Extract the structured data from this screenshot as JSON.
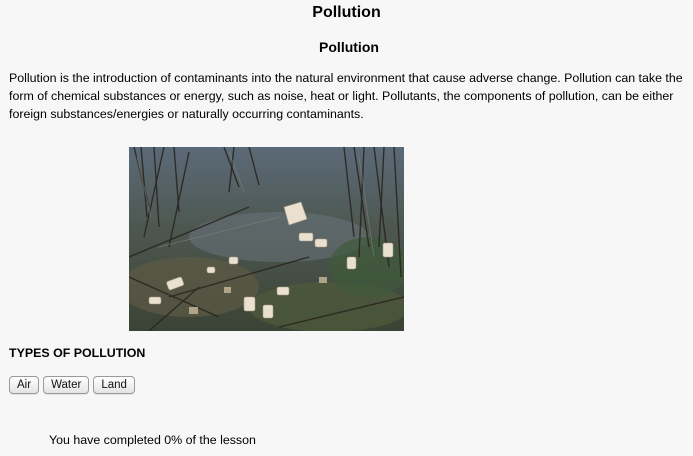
{
  "page": {
    "title": "Pollution"
  },
  "section": {
    "title": "Pollution",
    "intro": "Pollution is the introduction of contaminants into the natural environment that cause adverse change. Pollution can take the form of chemical substances or energy, such as noise, heat or light. Pollutants, the components of pollution, can be either foreign substances/energies or naturally occurring contaminants."
  },
  "types": {
    "heading": "TYPES OF POLLUTION",
    "buttons": [
      "Air",
      "Water",
      "Land"
    ]
  },
  "progress": {
    "text": "You have completed 0% of the lesson",
    "percent": 0
  }
}
